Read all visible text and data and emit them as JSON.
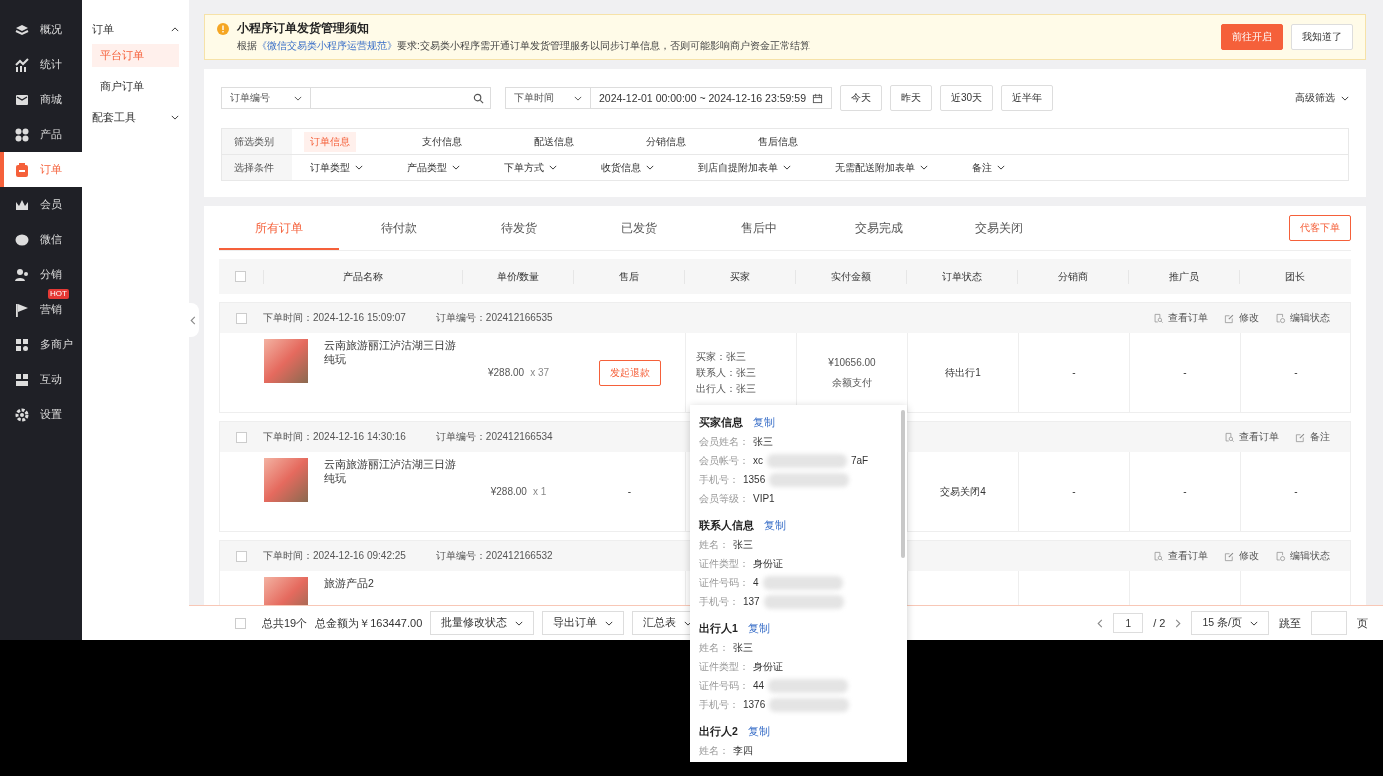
{
  "sidebar": {
    "items": [
      {
        "label": "概况",
        "selected": false
      },
      {
        "label": "统计",
        "selected": false
      },
      {
        "label": "商城",
        "selected": false
      },
      {
        "label": "产品",
        "selected": false
      },
      {
        "label": "订单",
        "selected": true
      },
      {
        "label": "会员",
        "selected": false
      },
      {
        "label": "微信",
        "selected": false
      },
      {
        "label": "分销",
        "selected": false
      },
      {
        "label": "营销",
        "selected": false,
        "badge": "HOT"
      },
      {
        "label": "多商户",
        "selected": false
      },
      {
        "label": "互动",
        "selected": false
      },
      {
        "label": "设置",
        "selected": false
      }
    ]
  },
  "subnav": {
    "groups": [
      {
        "label": "订单",
        "expanded": true,
        "children": [
          {
            "label": "平台订单",
            "selected": true
          },
          {
            "label": "商户订单",
            "selected": false
          }
        ]
      },
      {
        "label": "配套工具",
        "expanded": false
      }
    ]
  },
  "notice": {
    "title": "小程序订单发货管理须知",
    "text_before": "根据",
    "link": "《微信交易类小程序运营规范》",
    "text_after": "要求:交易类小程序需开通订单发货管理服务以同步订单信息，否则可能影响商户资金正常结算",
    "buttons": [
      {
        "label": "前往开启",
        "kind": "primary"
      },
      {
        "label": "我知道了",
        "kind": "default"
      }
    ]
  },
  "filters": {
    "search_type": "订单编号",
    "date_type": "下单时间",
    "date_range": "2024-12-01 00:00:00 ~ 2024-12-16 23:59:59",
    "quick_buttons": [
      "今天",
      "昨天",
      "近30天",
      "近半年"
    ],
    "advanced": "高级筛选",
    "rows": [
      {
        "label": "筛选类别",
        "kind": "tabs",
        "options": [
          {
            "label": "订单信息",
            "selected": true
          },
          {
            "label": "支付信息",
            "selected": false
          },
          {
            "label": "配送信息",
            "selected": false
          },
          {
            "label": "分销信息",
            "selected": false
          },
          {
            "label": "售后信息",
            "selected": false
          }
        ]
      },
      {
        "label": "选择条件",
        "kind": "dropdowns",
        "options": [
          {
            "label": "订单类型",
            "selected": false
          },
          {
            "label": "产品类型",
            "selected": false
          },
          {
            "label": "下单方式",
            "selected": false
          },
          {
            "label": "收货信息",
            "selected": false
          },
          {
            "label": "到店自提附加表单",
            "selected": false
          },
          {
            "label": "无需配送附加表单",
            "selected": false
          },
          {
            "label": "备注",
            "selected": false
          }
        ]
      }
    ]
  },
  "order_tabs": [
    {
      "label": "所有订单",
      "selected": true
    },
    {
      "label": "待付款",
      "selected": false
    },
    {
      "label": "待发货",
      "selected": false
    },
    {
      "label": "已发货",
      "selected": false
    },
    {
      "label": "售后中",
      "selected": false
    },
    {
      "label": "交易完成",
      "selected": false
    },
    {
      "label": "交易关闭",
      "selected": false
    }
  ],
  "proxy_order_button": "代客下单",
  "table": {
    "select_all_checked": false,
    "columns": [
      "产品名称",
      "单价/数量",
      "售后",
      "买家",
      "实付金额",
      "订单状态",
      "分销商",
      "推广员",
      "团长"
    ]
  },
  "orders": [
    {
      "time_label": "下单时间：",
      "time": "2024-12-16 15:09:07",
      "number_label": "订单编号：",
      "number": "202412166535",
      "checked": false,
      "actions": [
        {
          "label": "查看订单",
          "kind": "view"
        },
        {
          "label": "修改",
          "kind": "edit"
        },
        {
          "label": "编辑状态",
          "kind": "status"
        }
      ],
      "product": "云南旅游丽江泸沽湖三日游纯玩",
      "price": "¥288.00",
      "quantity": "x 37",
      "after_sale": {
        "kind": "button",
        "label": "发起退款"
      },
      "buyer": [
        {
          "label": "买家：",
          "value": "张三"
        },
        {
          "label": "联系人：",
          "value": "张三"
        },
        {
          "label": "出行人：",
          "value": "张三"
        }
      ],
      "paid": "¥10656.00",
      "pay_method": "余额支付",
      "status": "待出行1",
      "distributor": "-",
      "promoter": "-",
      "leader": "-"
    },
    {
      "time_label": "下单时间：",
      "time": "2024-12-16 14:30:16",
      "number_label": "订单编号：",
      "number": "202412166534",
      "checked": false,
      "actions": [
        {
          "label": "查看订单",
          "kind": "view"
        },
        {
          "label": "备注",
          "kind": "edit"
        }
      ],
      "product": "云南旅游丽江泸沽湖三日游纯玩",
      "price": "¥288.00",
      "quantity": "x 1",
      "after_sale": {
        "kind": "text",
        "label": "-"
      },
      "status": "交易关闭4",
      "distributor": "-",
      "promoter": "-",
      "leader": "-"
    },
    {
      "time_label": "下单时间：",
      "time": "2024-12-16 09:42:25",
      "number_label": "订单编号：",
      "number": "202412166532",
      "checked": false,
      "actions": [
        {
          "label": "查看订单",
          "kind": "view"
        },
        {
          "label": "修改",
          "kind": "edit"
        },
        {
          "label": "编辑状态",
          "kind": "status"
        }
      ],
      "product": "旅游产品2"
    }
  ],
  "footer": {
    "select_all_checked": false,
    "total_count": "总共19个",
    "total_amount": "总金额为￥163447.00",
    "actions": [
      "批量修改状态",
      "导出订单",
      "汇总表"
    ],
    "page": "1",
    "page_total": "/ 2",
    "page_size": "15 条/页",
    "jump_label": "跳至",
    "page_unit": "页"
  },
  "popover": {
    "sections": [
      {
        "title": "买家信息",
        "copy": "复制",
        "fields": [
          {
            "label": "会员姓名：",
            "value": "张三",
            "redacted": false
          },
          {
            "label": "会员帐号：",
            "value": "xc",
            "tail": "7aF",
            "redacted": true
          },
          {
            "label": "手机号：",
            "value": "1356",
            "redacted": true
          },
          {
            "label": "会员等级：",
            "value": "VIP1",
            "redacted": false
          }
        ]
      },
      {
        "title": "联系人信息",
        "copy": "复制",
        "fields": [
          {
            "label": "姓名：",
            "value": "张三",
            "redacted": false
          },
          {
            "label": "证件类型：",
            "value": "身份证",
            "redacted": false
          },
          {
            "label": "证件号码：",
            "value": "4",
            "redacted": true
          },
          {
            "label": "手机号：",
            "value": "137",
            "redacted": true
          }
        ]
      },
      {
        "title": "出行人1",
        "copy": "复制",
        "fields": [
          {
            "label": "姓名：",
            "value": "张三",
            "redacted": false
          },
          {
            "label": "证件类型：",
            "value": "身份证",
            "redacted": false
          },
          {
            "label": "证件号码：",
            "value": "44",
            "redacted": true
          },
          {
            "label": "手机号：",
            "value": "1376",
            "redacted": true
          }
        ]
      },
      {
        "title": "出行人2",
        "copy": "复制",
        "fields": [
          {
            "label": "姓名：",
            "value": "李四",
            "redacted": false
          }
        ]
      }
    ]
  }
}
